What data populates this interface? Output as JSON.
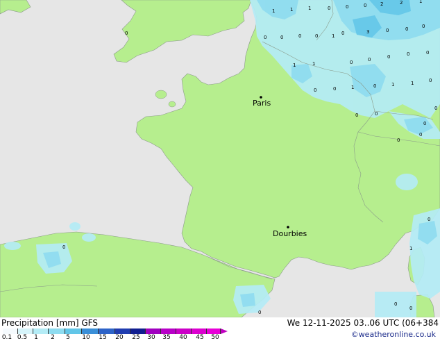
{
  "map": {
    "cities": [
      {
        "name": "Paris"
      },
      {
        "name": "Dourbies"
      }
    ],
    "precip_labels": [
      "1",
      "1",
      "1",
      "0",
      "0",
      "2",
      "2",
      "1",
      "0",
      "0",
      "3",
      "0",
      "0",
      "0",
      "0",
      "0",
      "1",
      "1",
      "0",
      "0",
      "1",
      "0",
      "0",
      "0",
      "0",
      "0",
      "0",
      "0",
      "1",
      "0",
      "1",
      "1",
      "0",
      "0",
      "0",
      "0",
      "0",
      "0",
      "0",
      "1",
      "0",
      "0",
      "0",
      "0",
      "0",
      "0"
    ]
  },
  "footer": {
    "title": "Precipitation [mm]  GFS",
    "timestamp": "We 12-11-2025 03..06 UTC (06+384",
    "credit": "©weatheronline.co.uk",
    "scale": {
      "labels": [
        "0.1",
        "0.5",
        "1",
        "2",
        "5",
        "10",
        "15",
        "20",
        "25",
        "30",
        "35",
        "40",
        "45",
        "50"
      ],
      "colors": [
        "#f5fafd",
        "#d6f4fa",
        "#b4ecf6",
        "#8edcf0",
        "#62c6e8",
        "#3a8fd8",
        "#2d63c8",
        "#1f3cb0",
        "#111e90",
        "#a000c0",
        "#b800c8",
        "#cc00c8",
        "#dc00d0",
        "#e800d8"
      ]
    }
  }
}
